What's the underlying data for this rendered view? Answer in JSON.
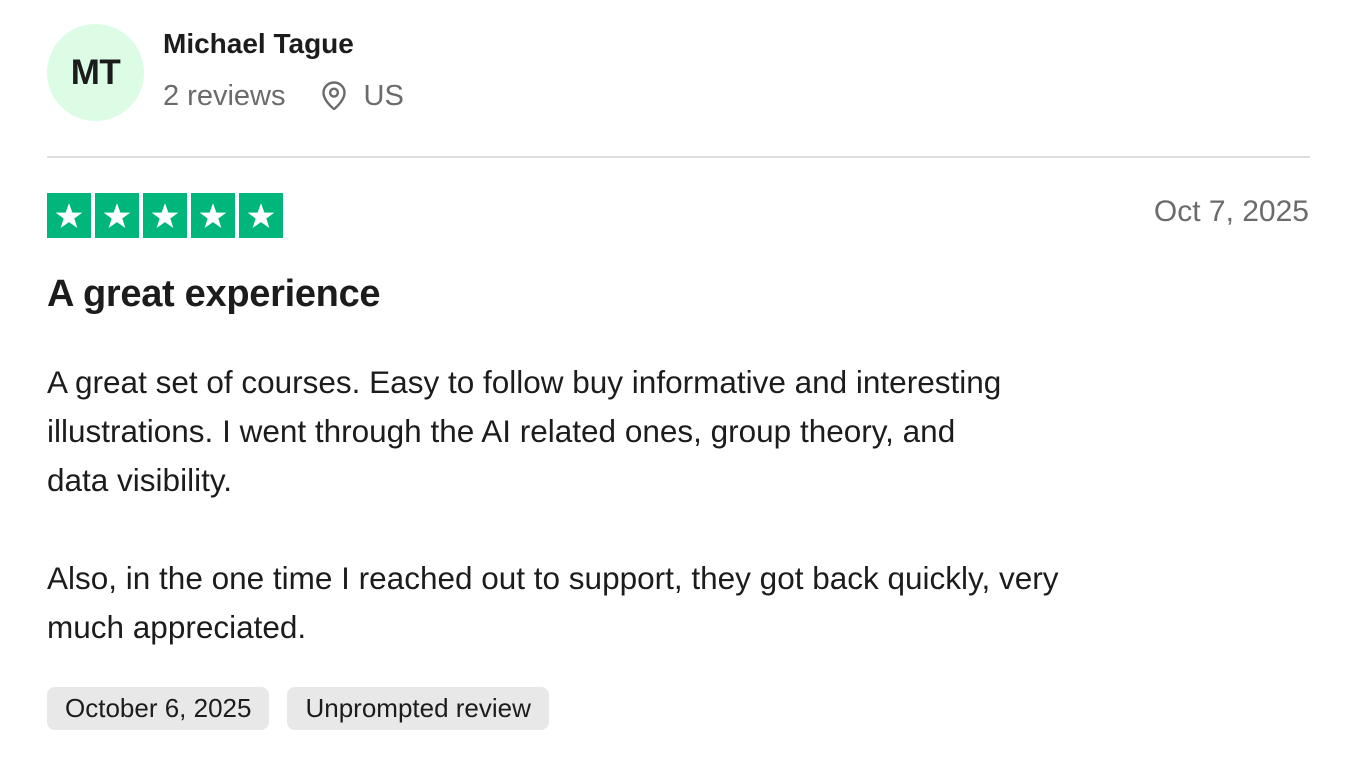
{
  "reviewer": {
    "initials": "MT",
    "name": "Michael Tague",
    "review_count": "2 reviews",
    "location": "US",
    "avatar_color": "#dcfce6"
  },
  "review": {
    "rating": 5,
    "rating_max": 5,
    "star_color": "#00b67a",
    "date": "Oct 7, 2025",
    "title": "A great experience",
    "body_paragraph_1_line_1": "A great set of courses. Easy to follow buy informative and interesting",
    "body_paragraph_1_line_2": "illustrations. I went through the AI related ones, group theory, and",
    "body_paragraph_1_line_3": "data visibility.",
    "body_paragraph_2_line_1": "Also, in the one time I reached out to support, they got back quickly, very",
    "body_paragraph_2_line_2": "much appreciated."
  },
  "tags": {
    "experience_date": "October 6, 2025",
    "review_type": "Unprompted review"
  },
  "icons": {
    "location": "map-pin-icon",
    "star": "star-icon"
  }
}
